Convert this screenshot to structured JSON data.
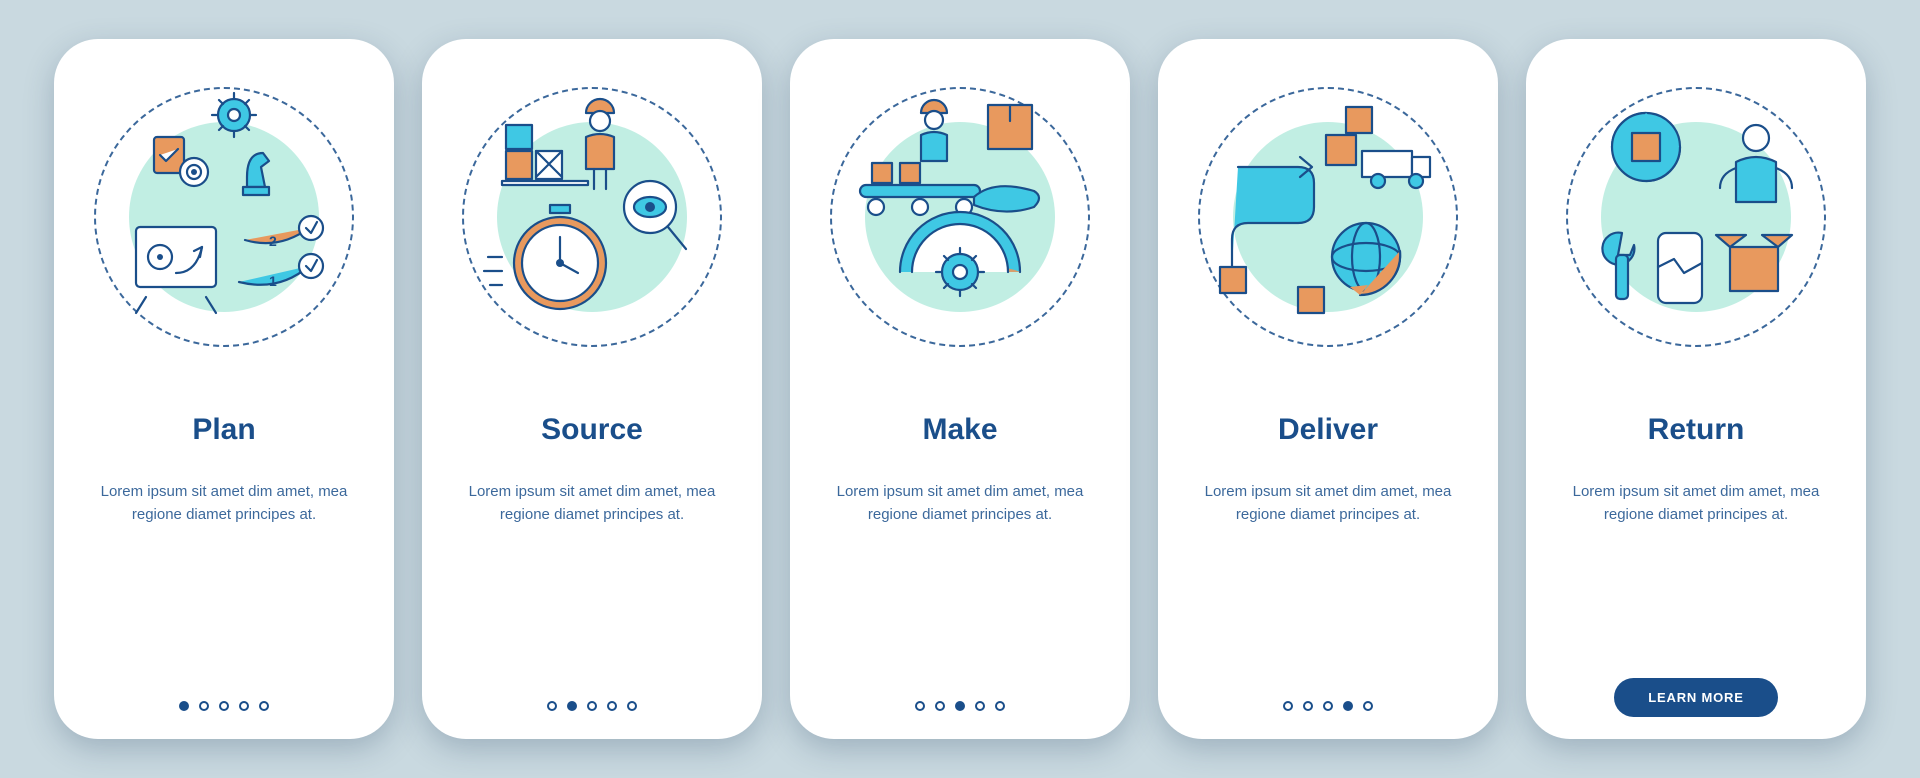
{
  "colors": {
    "bg": "#c9d9e0",
    "primary": "#1a4e8a",
    "accent_orange": "#e8995e",
    "accent_cyan": "#3fc8e4",
    "accent_mint": "#8ee0cc",
    "white": "#ffffff"
  },
  "screens": [
    {
      "title": "Plan",
      "description": "Lorem ipsum sit amet dim amet, mea regione diamet principes at.",
      "icon": "plan-icon",
      "active_page": 0,
      "has_cta": false
    },
    {
      "title": "Source",
      "description": "Lorem ipsum sit amet dim amet, mea regione diamet principes at.",
      "icon": "source-icon",
      "active_page": 1,
      "has_cta": false
    },
    {
      "title": "Make",
      "description": "Lorem ipsum sit amet dim amet, mea regione diamet principes at.",
      "icon": "make-icon",
      "active_page": 2,
      "has_cta": false
    },
    {
      "title": "Deliver",
      "description": "Lorem ipsum sit amet dim amet, mea regione diamet principes at.",
      "icon": "deliver-icon",
      "active_page": 3,
      "has_cta": false
    },
    {
      "title": "Return",
      "description": "Lorem ipsum sit amet dim amet, mea regione diamet principes at.",
      "icon": "return-icon",
      "active_page": 4,
      "has_cta": true
    }
  ],
  "total_pages": 5,
  "cta_label": "LEARN MORE"
}
